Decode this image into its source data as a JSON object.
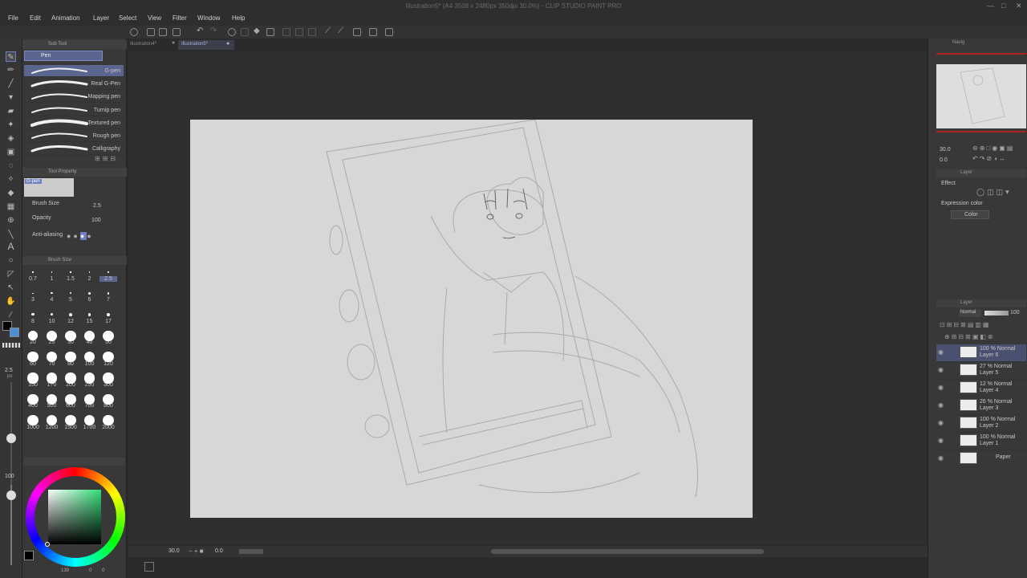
{
  "window": {
    "title": "Illustration5* (A4 3508 x 2480px 350dpi 30.0%) - CLIP STUDIO PAINT PRO",
    "controls": [
      "—",
      "□",
      "✕"
    ]
  },
  "menu": [
    "File",
    "Edit",
    "Animation",
    "Layer",
    "Select",
    "View",
    "Filter",
    "Window",
    "Help"
  ],
  "tabs": [
    {
      "label": "Illustration4*",
      "active": false
    },
    {
      "label": "Illustration5*",
      "active": true
    }
  ],
  "subtool": {
    "header": "Sub Tool",
    "group": "Pen",
    "brushes": [
      "G-pen",
      "Real G-Pen",
      "Mapping pen",
      "Turnip pen",
      "Textured pen",
      "Rough pen",
      "Calligraphy"
    ],
    "selected": "G-pen"
  },
  "tool_property": {
    "header": "Tool Property",
    "preview_label": "G-pen",
    "brush_size_label": "Brush Size",
    "brush_size": "2.5",
    "opacity_label": "Opacity",
    "opacity": "100",
    "antialias_label": "Anti-aliasing"
  },
  "brush_size_panel": {
    "header": "Brush Size",
    "sizes": [
      "0.7",
      "1",
      "1.5",
      "2",
      "2.5",
      "3",
      "4",
      "5",
      "6",
      "7",
      "8",
      "10",
      "12",
      "15",
      "17",
      "20",
      "25",
      "30",
      "40",
      "50",
      "60",
      "70",
      "80",
      "100",
      "120",
      "150",
      "170",
      "200",
      "250",
      "300",
      "400",
      "500",
      "600",
      "700",
      "800",
      "1000",
      "1200",
      "1500",
      "1700",
      "2000"
    ],
    "selected": "2.5"
  },
  "left_strip": {
    "size_value": "2.5",
    "size_unit": "px",
    "opacity_value": "100"
  },
  "color_wheel": {
    "hex": "#00cc66",
    "rgb_readout": "139",
    "readout_2": "0",
    "readout_3": "0"
  },
  "navigator": {
    "label": "Navig",
    "zoom": "30.0",
    "angle": "0.0"
  },
  "layer_property": {
    "tab": "Layer",
    "effect_label": "Effect",
    "expression_color_label": "Expression color",
    "expression_color": "Color"
  },
  "layers_panel": {
    "tab": "Layer",
    "blend_mode": "Normal",
    "opacity": "100",
    "layers": [
      {
        "pct": "100 % Normal",
        "name": "Layer 6",
        "selected": true
      },
      {
        "pct": "27 % Normal",
        "name": "Layer 5",
        "selected": false
      },
      {
        "pct": "12 % Normal",
        "name": "Layer 4",
        "selected": false
      },
      {
        "pct": "26 % Normal",
        "name": "Layer 3",
        "selected": false
      },
      {
        "pct": "100 % Normal",
        "name": "Layer 2",
        "selected": false
      },
      {
        "pct": "100 % Normal",
        "name": "Layer 1",
        "selected": false
      },
      {
        "pct": "",
        "name": "Paper",
        "selected": false
      }
    ]
  },
  "status": {
    "zoom": "30.0",
    "angle": "0.0"
  },
  "colors": {
    "accent": "#6f7fc0",
    "selection": "#5a6690",
    "panel": "#383838",
    "canvas": "#d7d7d7"
  }
}
